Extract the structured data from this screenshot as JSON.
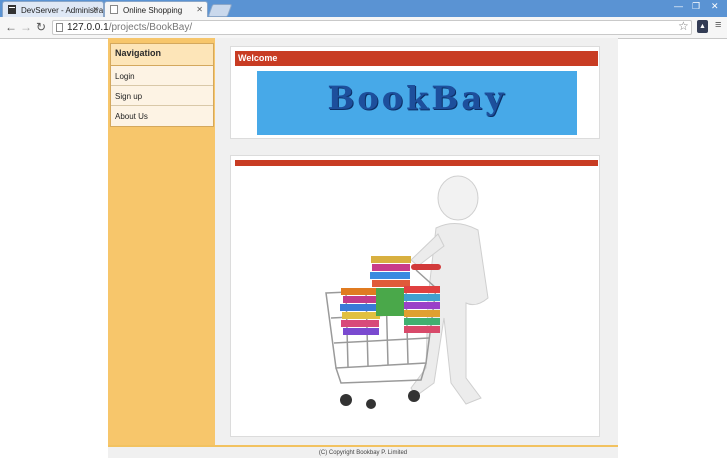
{
  "browser": {
    "tabs": [
      {
        "title": "DevServer - Administratio"
      },
      {
        "title": "Online Shopping"
      }
    ],
    "address": {
      "host": "127.0.0.1",
      "path": "/projects/BookBay/"
    }
  },
  "navigation": {
    "heading": "Navigation",
    "items": [
      {
        "label": "Login"
      },
      {
        "label": "Sign up"
      },
      {
        "label": "About Us"
      }
    ]
  },
  "welcome": {
    "heading": "Welcome",
    "logo_text": "BookBay"
  },
  "footer": {
    "text": "(C) Copyright Bookbay P. Limited"
  },
  "colors": {
    "header_red": "#c83c23",
    "sidebar": "#f7c66b",
    "banner": "#47a9e8"
  }
}
